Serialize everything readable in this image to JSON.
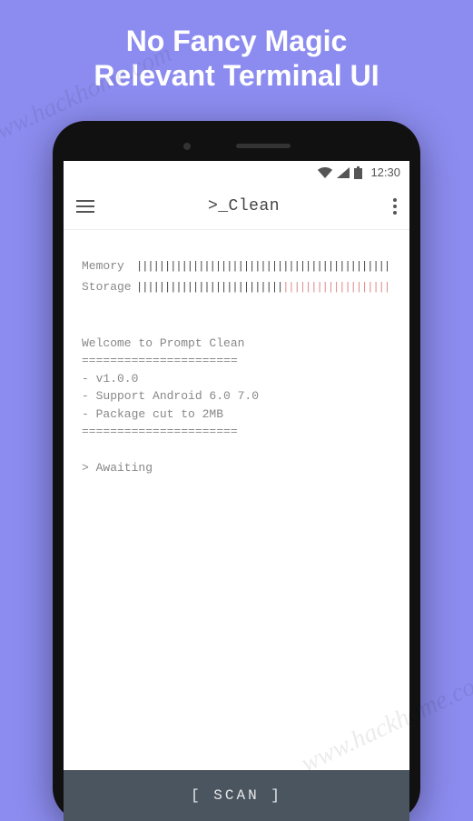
{
  "promo": {
    "line1": "No Fancy Magic",
    "line2": "Relevant Terminal UI"
  },
  "status": {
    "time": "12:30"
  },
  "appbar": {
    "title": ">_Clean"
  },
  "gauges": {
    "memory": {
      "label": "Memory"
    },
    "storage": {
      "label": "Storage"
    }
  },
  "terminal": {
    "welcome": "Welcome to Prompt Clean",
    "divider": "======================",
    "line1": "- v1.0.0",
    "line2": "- Support Android 6.0 7.0",
    "line3": "- Package cut to 2MB",
    "awaiting": "> Awaiting"
  },
  "scan": {
    "label": "[ SCAN ]"
  },
  "watermark": "www.hackhome.com"
}
